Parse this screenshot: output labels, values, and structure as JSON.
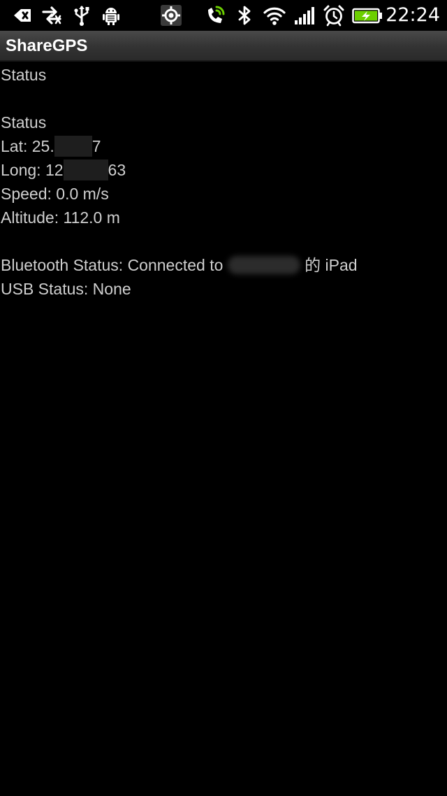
{
  "status_bar": {
    "time": "22:24",
    "icons": [
      "back-notify-icon",
      "data-sync-icon",
      "usb-icon",
      "android-debug-icon",
      "gps-icon",
      "phone-signal-icon",
      "bluetooth-icon",
      "wifi-icon",
      "cell-signal-icon",
      "alarm-icon",
      "battery-charging-icon"
    ],
    "accent_color": "#6ccf00"
  },
  "app_bar": {
    "title": "ShareGPS"
  },
  "content": {
    "header": "Status",
    "section_title": "Status",
    "lat_label": "Lat: 25.",
    "lat_suffix": "7",
    "long_label": "Long: 12",
    "long_suffix": "63",
    "speed": "Speed: 0.0 m/s",
    "altitude": "Altitude: 112.0 m",
    "bluetooth_prefix": "Bluetooth Status: Connected to",
    "bluetooth_suffix": "的 iPad",
    "usb_status": "USB Status: None"
  }
}
